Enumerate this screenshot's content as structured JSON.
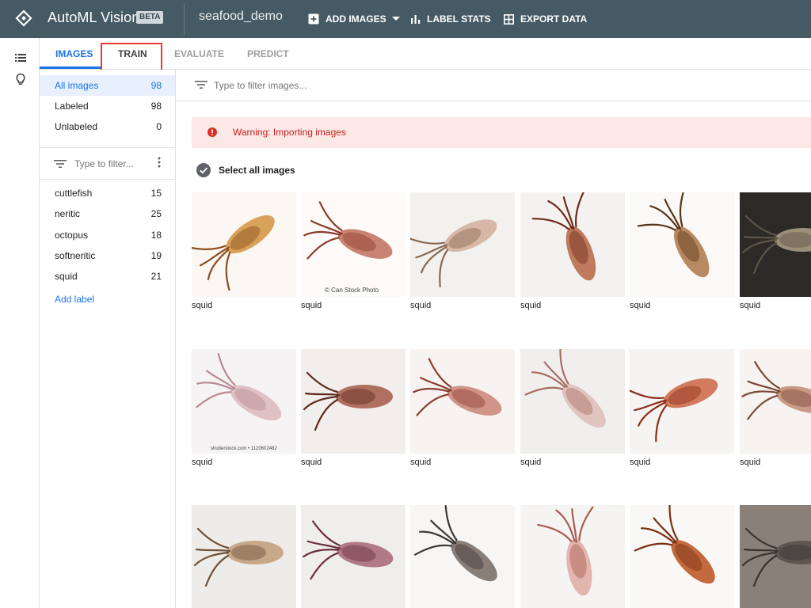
{
  "header": {
    "app_title": "AutoML Vision",
    "beta_badge": "BETA",
    "dataset_name": "seafood_demo",
    "add_images_label": "ADD IMAGES",
    "label_stats_label": "LABEL STATS",
    "export_data_label": "EXPORT DATA"
  },
  "rail": {
    "icons": [
      "list-icon",
      "lightbulb-icon"
    ]
  },
  "tabs": [
    {
      "label": "IMAGES",
      "active": true
    },
    {
      "label": "TRAIN",
      "active": false,
      "highlighted": true
    },
    {
      "label": "EVALUATE",
      "active": false
    },
    {
      "label": "PREDICT",
      "active": false
    }
  ],
  "left_panel": {
    "summary": [
      {
        "label": "All images",
        "count": "98",
        "active": true
      },
      {
        "label": "Labeled",
        "count": "98"
      },
      {
        "label": "Unlabeled",
        "count": "0"
      }
    ],
    "filter_placeholder": "Type to filter...",
    "labels": [
      {
        "label": "cuttlefish",
        "count": "15"
      },
      {
        "label": "neritic",
        "count": "25"
      },
      {
        "label": "octopus",
        "count": "18"
      },
      {
        "label": "softneritic",
        "count": "19"
      },
      {
        "label": "squid",
        "count": "21"
      }
    ],
    "add_label": "Add label"
  },
  "main": {
    "filter_placeholder": "Type to filter images...",
    "warning_text": "Warning: Importing images",
    "select_all": "Select all images",
    "images": [
      {
        "label": "squid"
      },
      {
        "label": "squid",
        "watermark": "© Can Stock Photo"
      },
      {
        "label": "squid"
      },
      {
        "label": "squid"
      },
      {
        "label": "squid"
      },
      {
        "label": "squid"
      },
      {
        "label": "squid",
        "watermark": "shutterstock.com • 1120602482"
      },
      {
        "label": "squid"
      },
      {
        "label": "squid"
      },
      {
        "label": "squid"
      },
      {
        "label": "squid"
      },
      {
        "label": "squid"
      },
      {
        "label": ""
      },
      {
        "label": ""
      },
      {
        "label": ""
      },
      {
        "label": ""
      },
      {
        "label": ""
      },
      {
        "label": ""
      }
    ]
  },
  "colors": {
    "topbar": "#455a64",
    "accent": "#1a73e8",
    "warning_bg": "#fce8e6",
    "warning_text": "#c5221f",
    "highlight_box": "#e53935"
  }
}
